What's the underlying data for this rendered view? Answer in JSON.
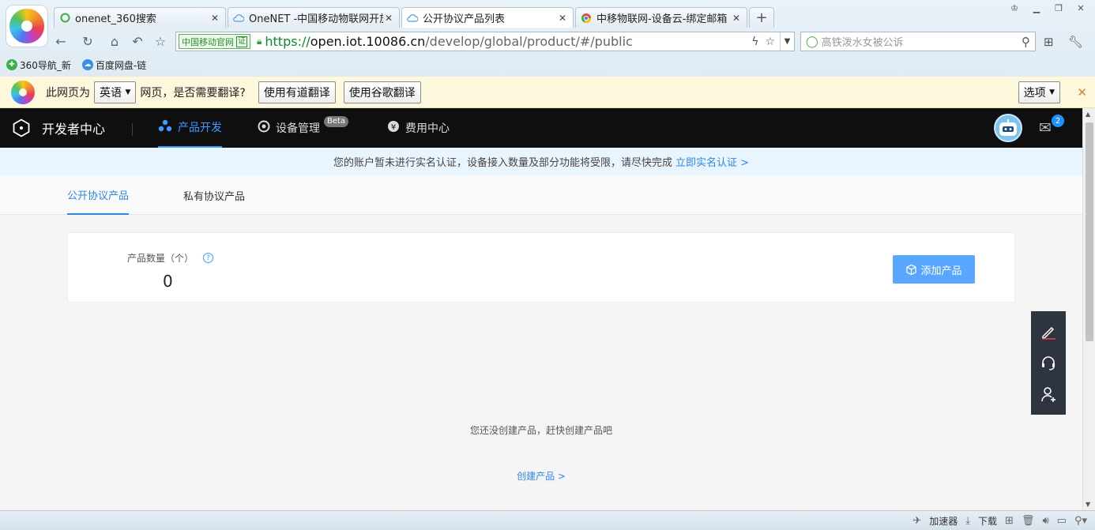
{
  "browser": {
    "tabs": [
      {
        "title": "onenet_360搜索",
        "icon": "search-360-icon",
        "active": false
      },
      {
        "title": "OneNET -中国移动物联网开放",
        "icon": "cloud-icon",
        "active": false
      },
      {
        "title": "公开协议产品列表",
        "icon": "cloud-icon",
        "active": true
      },
      {
        "title": "中移物联网-设备云-绑定邮箱 -",
        "icon": "chrome-icon",
        "active": false
      }
    ],
    "new_tab_label": "+",
    "cert_label": "中国移动官网",
    "cert_mark": "证",
    "url_scheme": "https://",
    "url_host": "open.iot.10086.cn",
    "url_path": "/develop/global/product/#/public",
    "search_placeholder": "高铁泼水女被公诉",
    "bookmarks": [
      {
        "label": "360导航_新",
        "icon": "360-nav-icon"
      },
      {
        "label": "百度网盘-链",
        "icon": "baidu-pan-icon"
      }
    ],
    "translate": {
      "prefix": "此网页为",
      "language": "英语",
      "question": "网页，是否需要翻译?",
      "youdao": "使用有道翻译",
      "google": "使用谷歌翻译",
      "options": "选项"
    },
    "status": {
      "accelerator": "加速器",
      "download": "下载"
    }
  },
  "header": {
    "brand": "开发者中心",
    "nav": [
      {
        "label": "产品开发",
        "icon": "product-dev-icon",
        "active": true
      },
      {
        "label": "设备管理",
        "icon": "device-icon",
        "active": false,
        "badge": "Beta"
      },
      {
        "label": "费用中心",
        "icon": "yen-icon",
        "active": false
      }
    ],
    "mail_count": "2"
  },
  "notice": {
    "text": "您的账户暂未进行实名认证，设备接入数量及部分功能将受限，请尽快完成",
    "link": "立即实名认证 >"
  },
  "subtabs": [
    {
      "label": "公开协议产品",
      "active": true
    },
    {
      "label": "私有协议产品",
      "active": false
    }
  ],
  "summary": {
    "count_label": "产品数量（个）",
    "count_value": "0",
    "add_button": "添加产品"
  },
  "empty": {
    "message": "您还没创建产品，赶快创建产品吧",
    "create_link": "创建产品 >"
  },
  "colors": {
    "accent": "#2f87e8",
    "header_bg": "#0f0f0f",
    "notice_bg": "#e9f5fe",
    "add_button_bg": "#59a6ff"
  }
}
